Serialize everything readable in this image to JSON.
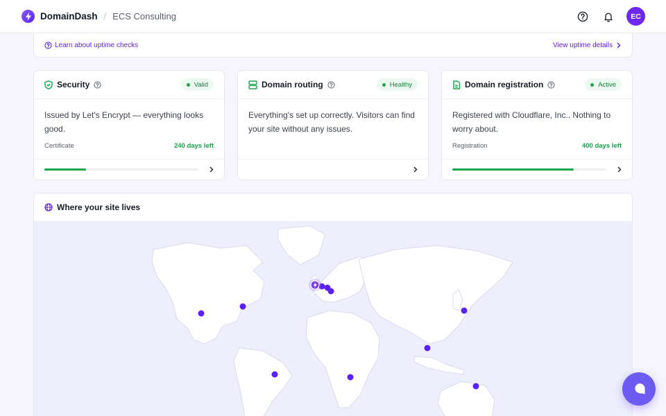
{
  "header": {
    "brand": "DomainDash",
    "separator": "/",
    "org": "ECS Consulting",
    "avatar_initials": "EC",
    "icons": [
      "bolt-icon",
      "help-circle-icon",
      "bell-icon"
    ]
  },
  "uptime": {
    "learn_link": "Learn about uptime checks",
    "details_link": "View uptime details"
  },
  "cards": [
    {
      "title": "Security",
      "icon": "shield-check-icon",
      "status": "Valid",
      "description": "Issued by Let's Encrypt — everything looks good.",
      "meta_label": "Certificate",
      "meta_value": "240 days left",
      "progress": 0.27
    },
    {
      "title": "Domain routing",
      "icon": "server-icon",
      "status": "Healthy",
      "description": "Everything's set up correctly. Visitors can find your site without any issues."
    },
    {
      "title": "Domain registration",
      "icon": "document-icon",
      "status": "Active",
      "description": "Registered with Cloudflare, Inc.. Nothing to worry about.",
      "meta_label": "Registration",
      "meta_value": "400 days left",
      "progress": 0.79
    }
  ],
  "map": {
    "title": "Where your site lives",
    "icon": "globe-icon"
  },
  "colors": {
    "accent": "#6d28f5",
    "success": "#16a34a",
    "map_dot": "#5b21f6",
    "map_land": "#ffffff",
    "map_water": "#eeeefc"
  }
}
